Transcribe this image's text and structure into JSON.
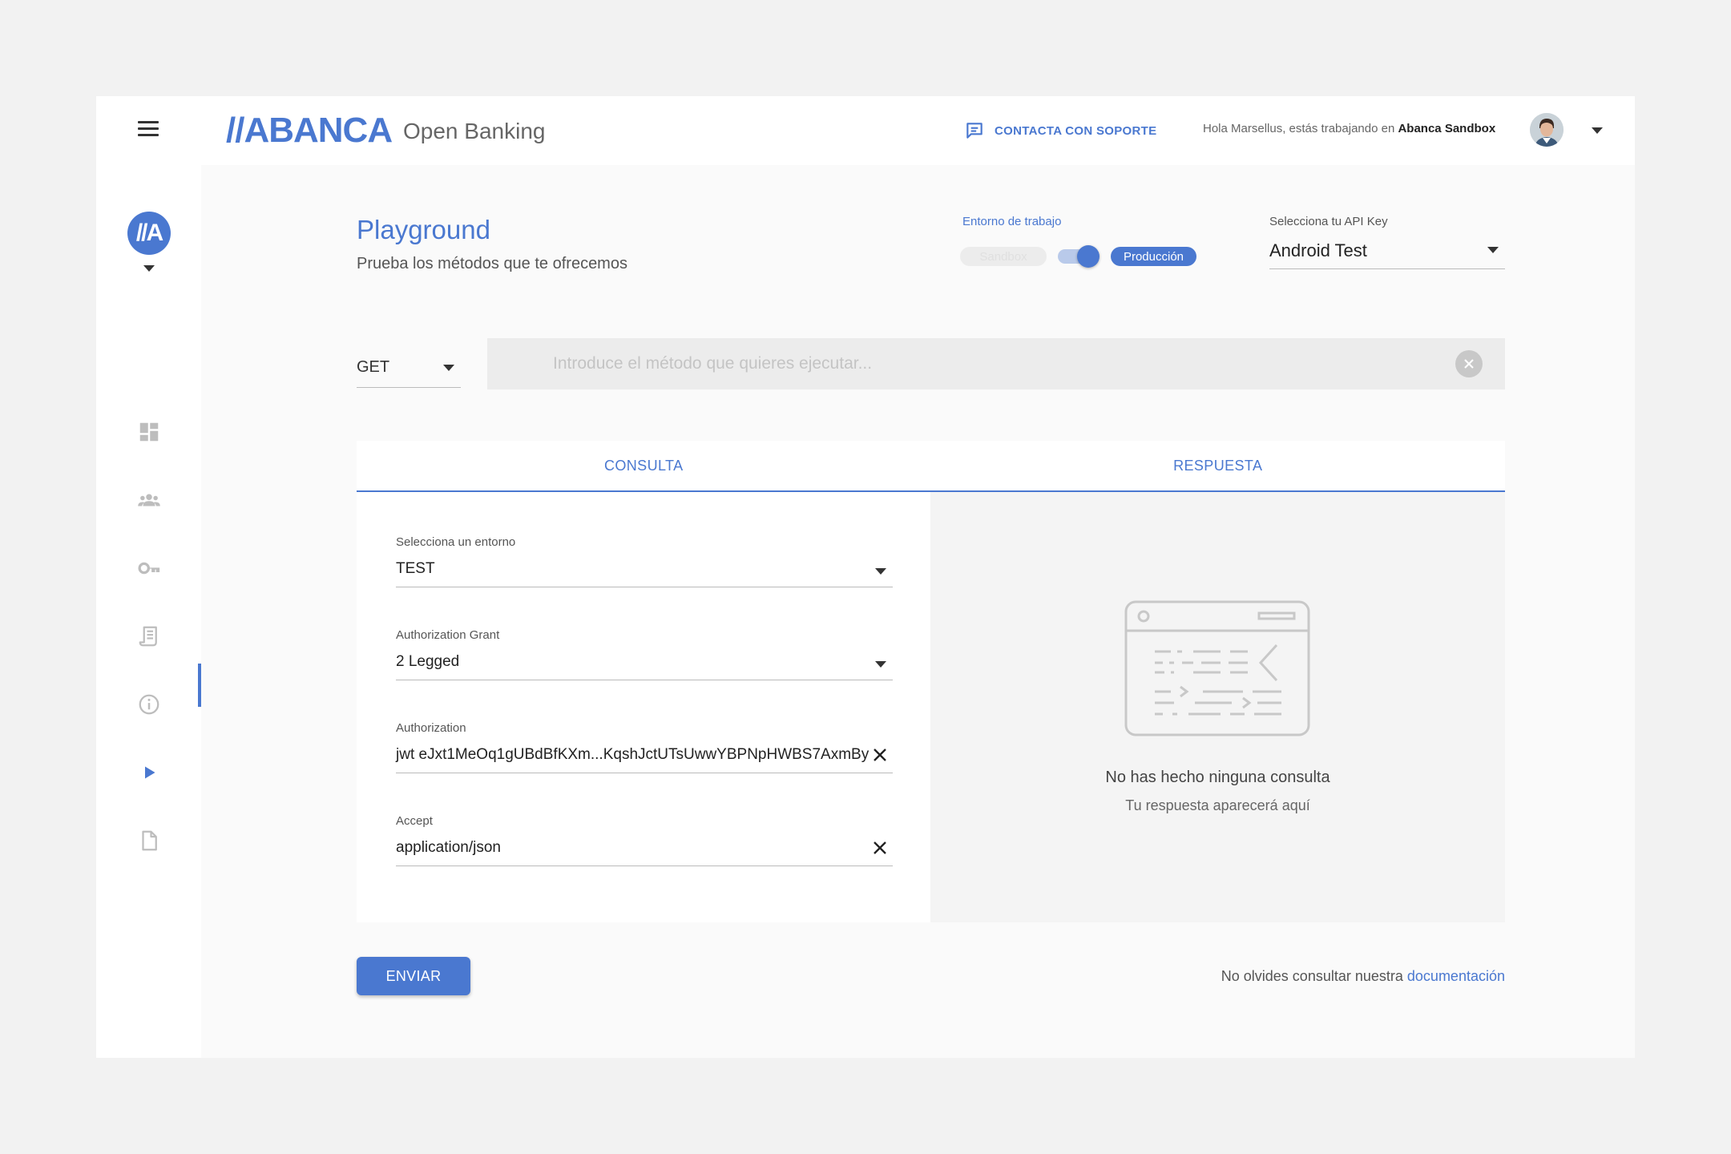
{
  "header": {
    "logo_text": "//ABANCA",
    "logo_subtitle": "Open Banking",
    "support_label": "CONTACTA CON SOPORTE",
    "greeting_prefix": "Hola Marsellus, estás trabajando en",
    "workspace": "Abanca Sandbox"
  },
  "sidebar": {
    "brand_initials": "//A",
    "items": [
      {
        "name": "dashboard",
        "icon": "dashboard-icon"
      },
      {
        "name": "users",
        "icon": "group-icon"
      },
      {
        "name": "keys",
        "icon": "key-icon"
      },
      {
        "name": "receipts",
        "icon": "receipt-icon"
      },
      {
        "name": "info",
        "icon": "info-icon"
      },
      {
        "name": "playground",
        "icon": "play-icon",
        "active": true
      },
      {
        "name": "documents",
        "icon": "document-icon"
      }
    ]
  },
  "page": {
    "title": "Playground",
    "subtitle": "Prueba los métodos que te ofrecemos"
  },
  "environment": {
    "label": "Entorno de trabajo",
    "option_off": "Sandbox",
    "option_on": "Producción",
    "selected": "Producción"
  },
  "api_key": {
    "label": "Selecciona tu API Key",
    "value": "Android Test"
  },
  "request": {
    "method": "GET",
    "placeholder": "Introduce el método que quieres ejecutar..."
  },
  "tabs": {
    "query": "CONSULTA",
    "response": "RESPUESTA"
  },
  "fields": [
    {
      "label": "Selecciona un entorno",
      "value": "TEST",
      "type": "select"
    },
    {
      "label": "Authorization Grant",
      "value": "2 Legged",
      "type": "select"
    },
    {
      "label": "Authorization",
      "value": "jwt eJxt1MeOq1gUBdBfKXm...KqshJctUTsUwwYBPNpHWBS7AxmBy",
      "type": "text"
    },
    {
      "label": "Accept",
      "value": "application/json",
      "type": "text"
    }
  ],
  "response": {
    "empty_title": "No has hecho ninguna consulta",
    "empty_subtitle": "Tu respuesta aparecerá aquí"
  },
  "footer": {
    "send_label": "ENVIAR",
    "docs_prefix": "No olvides consultar nuestra",
    "docs_link": "documentación"
  },
  "colors": {
    "accent": "#4a78d0",
    "background": "#fafafa",
    "panel": "#ffffff"
  }
}
